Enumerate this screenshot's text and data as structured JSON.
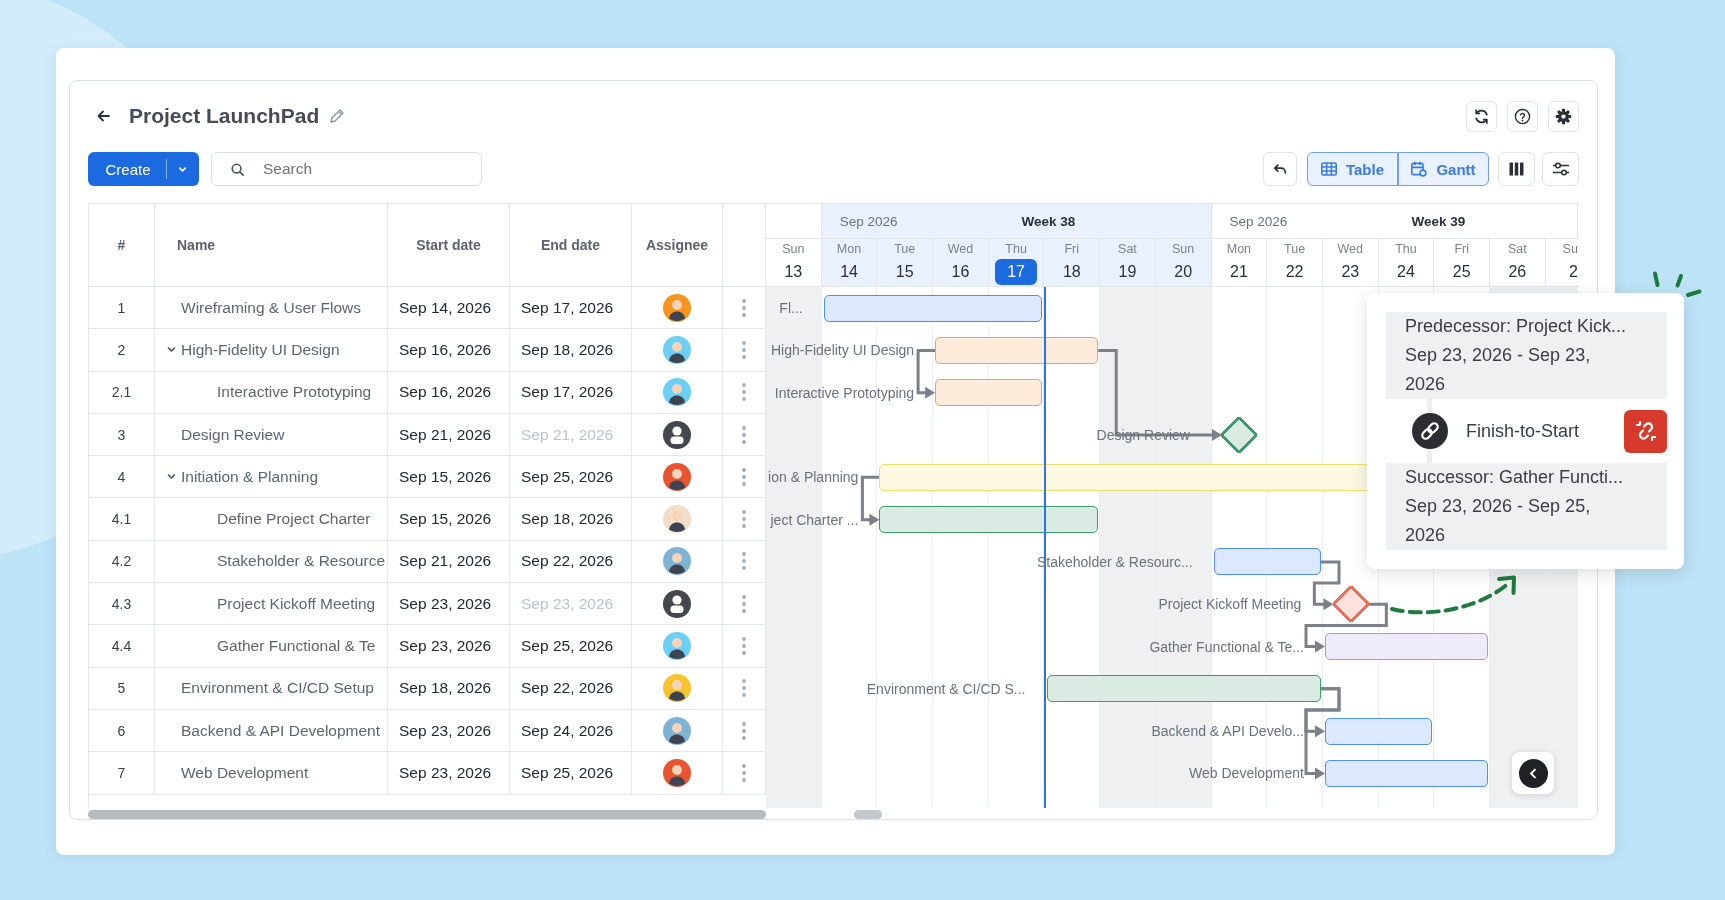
{
  "header": {
    "title": "Project LaunchPad"
  },
  "toolbar": {
    "create": "Create",
    "search": {
      "placeholder": "Search"
    },
    "views": [
      {
        "label": "Table",
        "selected": true
      },
      {
        "label": "Gantt",
        "selected": true
      }
    ]
  },
  "table": {
    "columns": [
      "#",
      "Name",
      "Start date",
      "End date",
      "Assignee"
    ],
    "rows": [
      {
        "number": "1",
        "name": "Wireframing & User Flows",
        "start": "Sep 14, 2026",
        "end": "Sep 17, 2026",
        "end_disabled": false,
        "assignee": {
          "kind": "person",
          "color": "#f7941d"
        }
      },
      {
        "number": "2",
        "name": "High-Fidelity UI Design",
        "start": "Sep 16, 2026",
        "end": "Sep 18, 2026",
        "end_disabled": false,
        "assignee": {
          "kind": "person",
          "color": "#6ccff6"
        },
        "expanded": true,
        "children": [
          {
            "number": "2.1",
            "name": "Interactive Prototyping",
            "start": "Sep 16, 2026",
            "end": "Sep 17, 2026",
            "end_disabled": false,
            "assignee": {
              "kind": "person",
              "color": "#6ccff6"
            }
          }
        ]
      },
      {
        "number": "3",
        "name": "Design Review",
        "start": "Sep 21, 2026",
        "end": "Sep 21, 2026",
        "end_disabled": true,
        "assignee": {
          "kind": "unassigned"
        }
      },
      {
        "number": "4",
        "name": "Initiation & Planning",
        "start": "Sep 15, 2026",
        "end": "Sep 25, 2026",
        "end_disabled": false,
        "assignee": {
          "kind": "person",
          "color": "#e8542f"
        },
        "expanded": true,
        "children": [
          {
            "number": "4.1",
            "name": "Define Project Charter",
            "start": "Sep 15, 2026",
            "end": "Sep 18, 2026",
            "end_disabled": false,
            "assignee": {
              "kind": "person",
              "color": "#f3dcc8"
            }
          },
          {
            "number": "4.2",
            "name": "Stakeholder & Resource",
            "start": "Sep 21, 2026",
            "end": "Sep 22, 2026",
            "end_disabled": false,
            "assignee": {
              "kind": "person",
              "color": "#7fb3d5"
            }
          },
          {
            "number": "4.3",
            "name": "Project Kickoff Meeting",
            "start": "Sep 23, 2026",
            "end": "Sep 23, 2026",
            "end_disabled": true,
            "assignee": {
              "kind": "unassigned"
            }
          },
          {
            "number": "4.4",
            "name": "Gather Functional & Te",
            "start": "Sep 23, 2026",
            "end": "Sep 25, 2026",
            "end_disabled": false,
            "assignee": {
              "kind": "person",
              "color": "#6ccff6"
            }
          }
        ]
      },
      {
        "number": "5",
        "name": "Environment & CI/CD Setup",
        "start": "Sep 18, 2026",
        "end": "Sep 22, 2026",
        "end_disabled": false,
        "assignee": {
          "kind": "person",
          "color": "#f6c431"
        }
      },
      {
        "number": "6",
        "name": "Backend & API Development",
        "start": "Sep 23, 2026",
        "end": "Sep 24, 2026",
        "end_disabled": false,
        "assignee": {
          "kind": "person",
          "color": "#7fb3d5"
        }
      },
      {
        "number": "7",
        "name": "Web Development",
        "start": "Sep 23, 2026",
        "end": "Sep 25, 2026",
        "end_disabled": false,
        "assignee": {
          "kind": "person",
          "color": "#e8542f"
        }
      }
    ]
  },
  "gantt": {
    "weeks": [
      {
        "current": false,
        "days": [
          {
            "weekday": "Sun",
            "date": "13",
            "weekend": true,
            "today": false
          }
        ]
      },
      {
        "month": "Sep 2026",
        "label": "Week 38",
        "current": true,
        "days": [
          {
            "weekday": "Mon",
            "date": "14",
            "weekend": false,
            "today": false
          },
          {
            "weekday": "Tue",
            "date": "15",
            "weekend": false,
            "today": false
          },
          {
            "weekday": "Wed",
            "date": "16",
            "weekend": false,
            "today": false
          },
          {
            "weekday": "Thu",
            "date": "17",
            "weekend": false,
            "today": true
          },
          {
            "weekday": "Fri",
            "date": "18",
            "weekend": false,
            "today": false
          },
          {
            "weekday": "Sat",
            "date": "19",
            "weekend": true,
            "today": false
          },
          {
            "weekday": "Sun",
            "date": "20",
            "weekend": true,
            "today": false
          }
        ]
      },
      {
        "month": "Sep 2026",
        "label": "Week 39",
        "current": false,
        "days": [
          {
            "weekday": "Mon",
            "date": "21",
            "weekend": false,
            "today": false
          },
          {
            "weekday": "Tue",
            "date": "22",
            "weekend": false,
            "today": false
          },
          {
            "weekday": "Wed",
            "date": "23",
            "weekend": false,
            "today": false
          },
          {
            "weekday": "Thu",
            "date": "24",
            "weekend": false,
            "today": false
          },
          {
            "weekday": "Fri",
            "date": "25",
            "weekend": false,
            "today": false
          },
          {
            "weekday": "Sat",
            "date": "26",
            "weekend": true,
            "today": false
          },
          {
            "weekday": "Su",
            "date": "2",
            "weekend": true,
            "today": false
          }
        ]
      }
    ],
    "rows": [
      {
        "label": "Fl...",
        "kind": "bar",
        "color": "#4d8ef7"
      },
      {
        "label": "High-Fidelity UI Design",
        "kind": "bar",
        "color": "#f5a14a"
      },
      {
        "label": "Interactive Prototyping",
        "kind": "bar",
        "color": "#f5a14a"
      },
      {
        "label": "Design Review",
        "kind": "milestone",
        "color": "#3f9a6e"
      },
      {
        "label": "ion & Planning",
        "kind": "bar",
        "color": "#f2dc6b"
      },
      {
        "label": "ject Charter ...",
        "kind": "bar",
        "color": "#3f9a6e"
      },
      {
        "label": "Stakeholder & Resourc...",
        "kind": "bar",
        "color": "#4d8ef7"
      },
      {
        "label": "Project Kickoff Meeting",
        "kind": "milestone",
        "color": "#f36b55"
      },
      {
        "label": "Gather Functional & Te...",
        "kind": "bar",
        "color": "#a996e8"
      },
      {
        "label": "Environment & CI/CD S...",
        "kind": "bar",
        "color": "#3f9a6e"
      },
      {
        "label": "Backend & API Develo...",
        "kind": "bar",
        "color": "#4d8ef7"
      },
      {
        "label": "Web Development",
        "kind": "bar",
        "color": "#4d8ef7"
      }
    ]
  },
  "popup": {
    "predecessor": {
      "title": "Predecessor: Project Kick...",
      "dates": "Sep 23, 2026 - Sep 23, 2026"
    },
    "link_type": "Finish-to-Start",
    "successor": {
      "title": "Successor: Gather Functi...",
      "dates": "Sep 23, 2026 - Sep 25, 2026"
    }
  }
}
